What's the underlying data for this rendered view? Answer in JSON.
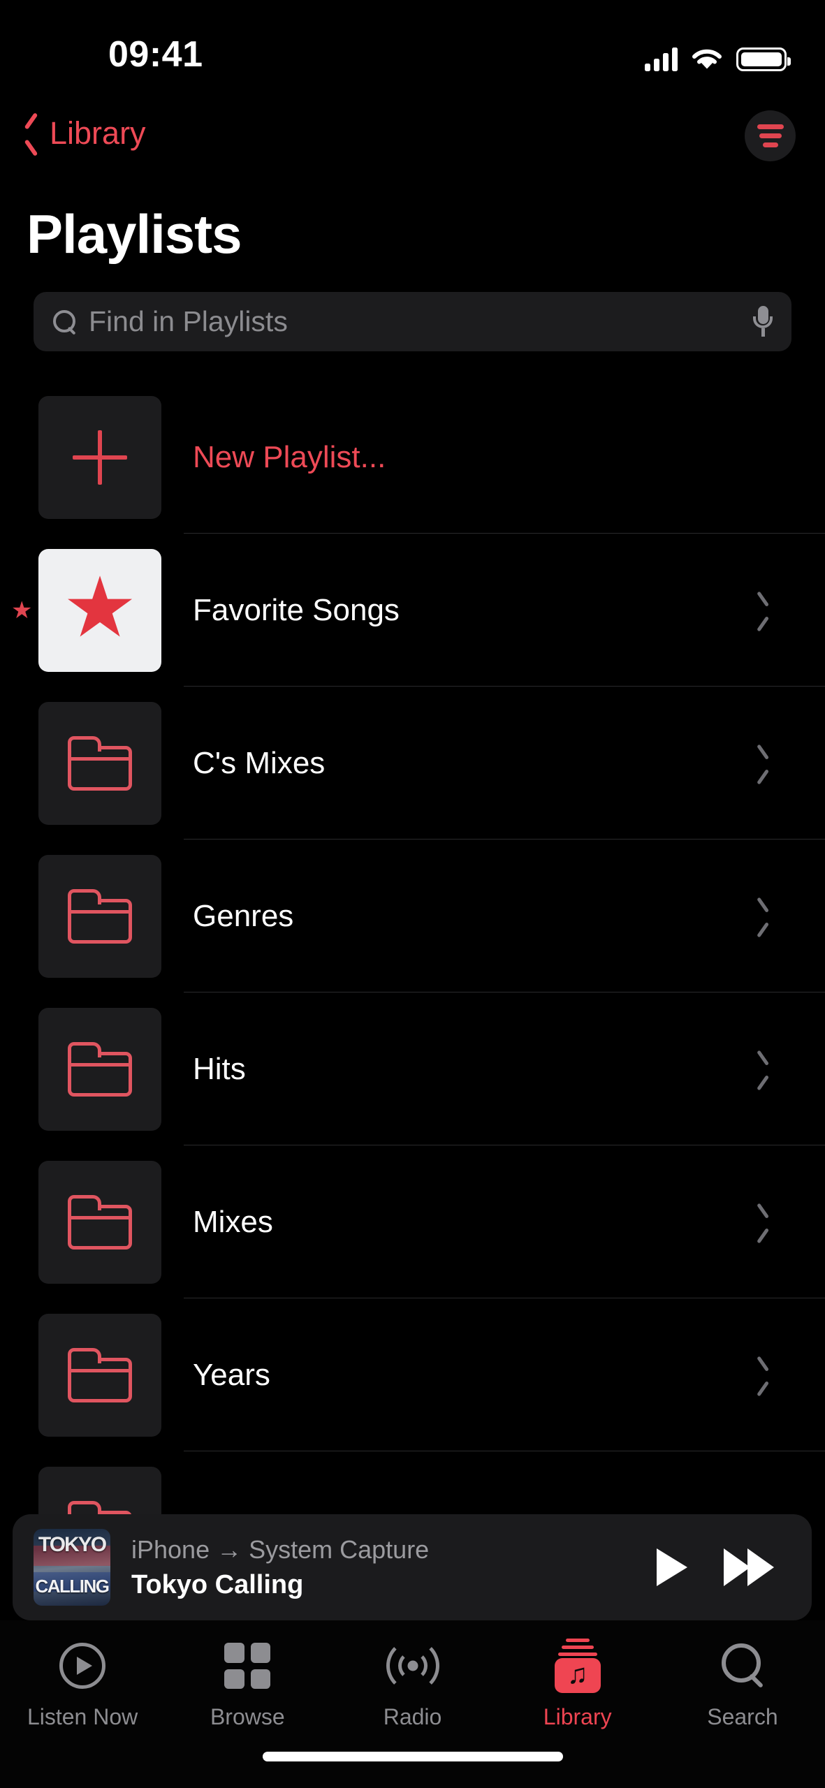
{
  "status_bar": {
    "time": "09:41",
    "cellular_icon": "cellular-bars-icon",
    "wifi_icon": "wifi-icon",
    "battery_icon": "battery-full-icon"
  },
  "nav": {
    "back_label": "Library",
    "back_icon": "chevron-left-icon",
    "filter_icon": "sort-filter-icon",
    "accent_color": "#ee4a56"
  },
  "header": {
    "title": "Playlists"
  },
  "search": {
    "placeholder": "Find in Playlists",
    "value": "",
    "search_icon": "search-icon",
    "mic_icon": "microphone-icon"
  },
  "list": {
    "items": [
      {
        "label": "New Playlist...",
        "icon": "plus-icon",
        "accent": true,
        "chevron": false,
        "starred": false
      },
      {
        "label": "Favorite Songs",
        "icon": "star-icon",
        "accent": false,
        "chevron": true,
        "starred": true
      },
      {
        "label": "C's Mixes",
        "icon": "folder-icon",
        "accent": false,
        "chevron": true,
        "starred": false
      },
      {
        "label": "Genres",
        "icon": "folder-icon",
        "accent": false,
        "chevron": true,
        "starred": false
      },
      {
        "label": "Hits",
        "icon": "folder-icon",
        "accent": false,
        "chevron": true,
        "starred": false
      },
      {
        "label": "Mixes",
        "icon": "folder-icon",
        "accent": false,
        "chevron": true,
        "starred": false
      },
      {
        "label": "Years",
        "icon": "folder-icon",
        "accent": false,
        "chevron": true,
        "starred": false
      }
    ],
    "star_glyph": "★"
  },
  "now_playing": {
    "route": "iPhone → System Capture",
    "title": "Tokyo Calling",
    "artwork_top_text": "TOKYO",
    "artwork_bottom_text": "CALLING",
    "play_icon": "play-icon",
    "forward_icon": "fast-forward-icon"
  },
  "tab_bar": {
    "tabs": [
      {
        "label": "Listen Now",
        "icon": "listen-now-icon",
        "active": false
      },
      {
        "label": "Browse",
        "icon": "browse-grid-icon",
        "active": false
      },
      {
        "label": "Radio",
        "icon": "radio-waves-icon",
        "active": false
      },
      {
        "label": "Library",
        "icon": "library-music-icon",
        "active": true
      },
      {
        "label": "Search",
        "icon": "search-icon",
        "active": false
      }
    ],
    "active_color": "#ef4552",
    "inactive_color": "#8d8d91",
    "library_note_glyph": "♫"
  }
}
